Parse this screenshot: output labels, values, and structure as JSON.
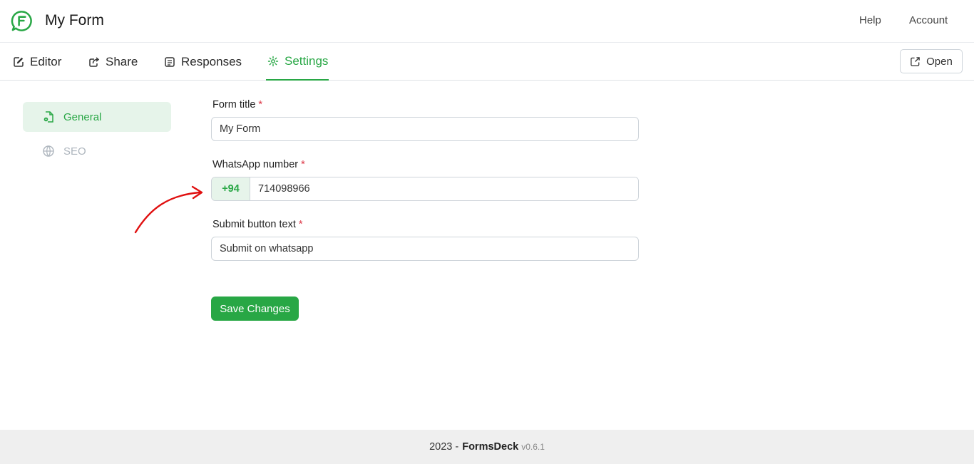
{
  "header": {
    "title": "My Form",
    "help_label": "Help",
    "account_label": "Account",
    "logo_icon": "form-chat-logo",
    "accent_color": "#28a745"
  },
  "tabs": [
    {
      "label": "Editor",
      "icon": "edit-icon"
    },
    {
      "label": "Share",
      "icon": "share-icon"
    },
    {
      "label": "Responses",
      "icon": "responses-icon"
    },
    {
      "label": "Settings",
      "icon": "gear-icon",
      "active": true
    }
  ],
  "open_button": {
    "label": "Open",
    "icon": "external-link-icon"
  },
  "sidebar": {
    "items": [
      {
        "label": "General",
        "icon": "file-gear-icon",
        "active": true
      },
      {
        "label": "SEO",
        "icon": "globe-icon"
      }
    ]
  },
  "form": {
    "title_label": "Form title",
    "title_value": "My Form",
    "whatsapp_label": "WhatsApp number",
    "country_code": "+94",
    "whatsapp_value": "714098966",
    "submit_label": "Submit button text",
    "submit_value": "Submit on whatsapp",
    "required_mark": "*",
    "save_label": "Save Changes"
  },
  "footer": {
    "year": "2023 -",
    "brand": "FormsDeck",
    "version": "v0.6.1"
  }
}
